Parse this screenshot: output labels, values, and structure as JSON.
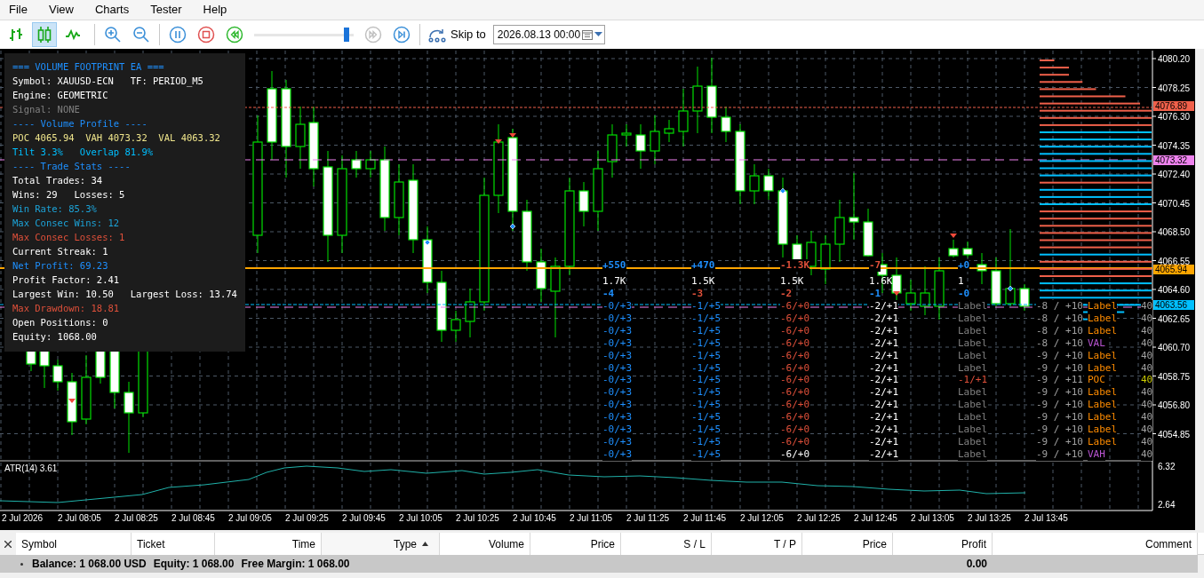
{
  "menu": [
    "File",
    "View",
    "Charts",
    "Tester",
    "Help"
  ],
  "toolbar": {
    "chart_types": [
      {
        "kind": "bars",
        "selected": false
      },
      {
        "kind": "candles",
        "selected": true
      },
      {
        "kind": "line",
        "selected": false
      }
    ],
    "speed": {
      "level": 0.95
    },
    "fast_forward": {
      "disabled": true
    },
    "skip_to": {
      "label": "Skip to",
      "value": "2026.08.13 00:00"
    }
  },
  "chart": {
    "info_panel": [
      {
        "text": "=== VOLUME FOOTPRINT EA ===",
        "color": "#1e90ff"
      },
      {
        "text": "Symbol: XAUUSD-ECN   TF: PERIOD_M5",
        "color": "#ffffff"
      },
      {
        "text": "Engine: GEOMETRIC",
        "color": "#ffffff"
      },
      {
        "text": "Signal: NONE",
        "color": "#808080"
      },
      {
        "text": "---- Volume Profile ----",
        "color": "#1e90ff"
      },
      {
        "text": "POC 4065.94  VAH 4073.32  VAL 4063.32",
        "color": "#f0e68c"
      },
      {
        "text": "Tilt 3.3%   Overlap 81.9%",
        "color": "#00bfff"
      },
      {
        "text": "---- Trade Stats ----",
        "color": "#1e90ff"
      },
      {
        "text": "Total Trades: 34",
        "color": "#ffffff"
      },
      {
        "text": "Wins: 29   Losses: 5",
        "color": "#ffffff"
      },
      {
        "text": "Win Rate: 85.3%",
        "color": "#1ca3d8"
      },
      {
        "text": "Max Consec Wins: 12",
        "color": "#1ca3d8"
      },
      {
        "text": "Max Consec Losses: 1",
        "color": "#e0503a"
      },
      {
        "text": "Current Streak: 1",
        "color": "#ffffff"
      },
      {
        "text": "Net Profit: 69.23",
        "color": "#1e90ff"
      },
      {
        "text": "Profit Factor: 2.41",
        "color": "#ffffff"
      },
      {
        "text": "Largest Win: 10.50   Largest Loss: 13.74",
        "color": "#ffffff"
      },
      {
        "text": "Max Drawdown: 18.81",
        "color": "#e0503a"
      },
      {
        "text": "Open Positions: 0",
        "color": "#ffffff"
      },
      {
        "text": "Equity: 1068.00",
        "color": "#ffffff"
      }
    ],
    "price_axis": [
      "4080.20",
      "4078.25",
      "4076.30",
      "4074.35",
      "4072.40",
      "4070.45",
      "4068.50",
      "4066.55",
      "4064.60",
      "4062.65",
      "4060.70",
      "4058.75",
      "4056.80",
      "4054.85"
    ],
    "price_tags": [
      {
        "text": "4076.89",
        "color": "#f0604a"
      },
      {
        "text": "4073.32",
        "color": "#ee82ee"
      },
      {
        "text": "4065.94",
        "color": "#ffa500"
      },
      {
        "text": "4063.56",
        "color": "#00bfff"
      }
    ],
    "footprint": {
      "columns": [
        {
          "delta": {
            "text": "+550",
            "color": "#1e90ff"
          },
          "volume": "1.7K",
          "imbalance": {
            "text": "-4",
            "color": "#1e90ff"
          },
          "cells": [
            {
              "text": "-0/+3",
              "color": "#1e90ff"
            },
            {
              "text": "-0/+3",
              "color": "#1e90ff"
            },
            {
              "text": "-0/+3",
              "color": "#1e90ff"
            },
            {
              "text": "-0/+3",
              "color": "#1e90ff"
            },
            {
              "text": "-0/+3",
              "color": "#1e90ff"
            },
            {
              "text": "-0/+3",
              "color": "#1e90ff"
            },
            {
              "text": "-0/+3",
              "color": "#1e90ff"
            },
            {
              "text": "-0/+3",
              "color": "#1e90ff"
            },
            {
              "text": "-0/+3",
              "color": "#1e90ff"
            },
            {
              "text": "-0/+3",
              "color": "#1e90ff"
            },
            {
              "text": "-0/+3",
              "color": "#1e90ff"
            },
            {
              "text": "-0/+3",
              "color": "#1e90ff"
            },
            {
              "text": "-0/+3",
              "color": "#1e90ff"
            }
          ]
        },
        {
          "delta": {
            "text": "+470",
            "color": "#1e90ff"
          },
          "volume": "1.5K",
          "imbalance": {
            "text": "-3",
            "color": "#e0503a"
          },
          "cells": [
            {
              "text": "-1/+5",
              "color": "#1e90ff"
            },
            {
              "text": "-1/+5",
              "color": "#1e90ff"
            },
            {
              "text": "-1/+5",
              "color": "#1e90ff"
            },
            {
              "text": "-1/+5",
              "color": "#1e90ff"
            },
            {
              "text": "-1/+5",
              "color": "#1e90ff"
            },
            {
              "text": "-1/+5",
              "color": "#1e90ff"
            },
            {
              "text": "-1/+5",
              "color": "#1e90ff"
            },
            {
              "text": "-1/+5",
              "color": "#1e90ff"
            },
            {
              "text": "-1/+5",
              "color": "#1e90ff"
            },
            {
              "text": "-1/+5",
              "color": "#1e90ff"
            },
            {
              "text": "-1/+5",
              "color": "#1e90ff"
            },
            {
              "text": "-1/+5",
              "color": "#1e90ff"
            },
            {
              "text": "-1/+5",
              "color": "#1e90ff"
            }
          ]
        },
        {
          "delta": {
            "text": "-1.3K",
            "color": "#e0503a"
          },
          "volume": "1.5K",
          "imbalance": {
            "text": "-2",
            "color": "#e0503a"
          },
          "cells": [
            {
              "text": "-6/+0",
              "color": "#e0503a"
            },
            {
              "text": "-6/+0",
              "color": "#e0503a"
            },
            {
              "text": "-6/+0",
              "color": "#e0503a"
            },
            {
              "text": "-6/+0",
              "color": "#e0503a"
            },
            {
              "text": "-6/+0",
              "color": "#e0503a"
            },
            {
              "text": "-6/+0",
              "color": "#e0503a"
            },
            {
              "text": "-6/+0",
              "color": "#e0503a"
            },
            {
              "text": "-6/+0",
              "color": "#e0503a"
            },
            {
              "text": "-6/+0",
              "color": "#e0503a"
            },
            {
              "text": "-6/+0",
              "color": "#e0503a"
            },
            {
              "text": "-6/+0",
              "color": "#e0503a"
            },
            {
              "text": "-6/+0",
              "color": "#e0503a"
            },
            {
              "text": "-6/+0",
              "color": "#ffffff"
            }
          ]
        },
        {
          "delta": {
            "text": "-7",
            "color": "#e0503a"
          },
          "volume": "1.6K",
          "imbalance": {
            "text": "-1",
            "color": "#1e90ff"
          },
          "cells": [
            {
              "text": "-2/+1",
              "color": "#ffffff"
            },
            {
              "text": "-2/+1",
              "color": "#ffffff"
            },
            {
              "text": "-2/+1",
              "color": "#ffffff"
            },
            {
              "text": "-2/+1",
              "color": "#ffffff"
            },
            {
              "text": "-2/+1",
              "color": "#ffffff"
            },
            {
              "text": "-2/+1",
              "color": "#ffffff"
            },
            {
              "text": "-2/+1",
              "color": "#ffffff"
            },
            {
              "text": "-2/+1",
              "color": "#ffffff"
            },
            {
              "text": "-2/+1",
              "color": "#ffffff"
            },
            {
              "text": "-2/+1",
              "color": "#ffffff"
            },
            {
              "text": "-2/+1",
              "color": "#ffffff"
            },
            {
              "text": "-2/+1",
              "color": "#ffffff"
            },
            {
              "text": "-2/+1",
              "color": "#ffffff"
            }
          ]
        },
        {
          "delta": {
            "text": "+0",
            "color": "#1e90ff"
          },
          "volume": "1",
          "imbalance": {
            "text": "-0",
            "color": "#1e90ff"
          },
          "cells": [
            {
              "text": "Label",
              "color": "#808080"
            },
            {
              "text": "Label",
              "color": "#808080"
            },
            {
              "text": "Label",
              "color": "#808080"
            },
            {
              "text": "Label",
              "color": "#808080"
            },
            {
              "text": "Label",
              "color": "#808080"
            },
            {
              "text": "Label",
              "color": "#808080"
            },
            {
              "text": "-1/+1",
              "color": "#e0503a"
            },
            {
              "text": "Label",
              "color": "#808080"
            },
            {
              "text": "Label",
              "color": "#808080"
            },
            {
              "text": "Label",
              "color": "#808080"
            },
            {
              "text": "Label",
              "color": "#808080"
            },
            {
              "text": "Label",
              "color": "#808080"
            },
            {
              "text": "Label",
              "color": "#808080"
            }
          ]
        }
      ],
      "levels": [
        {
          "ratio": "-8 / +10",
          "label": {
            "text": "Label",
            "color": "#ff8c00"
          },
          "count": {
            "text": "40",
            "color": "#a0a0a0"
          }
        },
        {
          "ratio": "-8 / +10",
          "label": {
            "text": "Label",
            "color": "#ff8c00"
          },
          "count": {
            "text": "40",
            "color": "#a0a0a0"
          }
        },
        {
          "ratio": "-8 / +10",
          "label": {
            "text": "Label",
            "color": "#ff8c00"
          },
          "count": {
            "text": "40",
            "color": "#a0a0a0"
          }
        },
        {
          "ratio": "-8 / +10",
          "label": {
            "text": "VAL",
            "color": "#ba55d3"
          },
          "count": {
            "text": "40",
            "color": "#a0a0a0"
          }
        },
        {
          "ratio": "-9 / +10",
          "label": {
            "text": "Label",
            "color": "#ff8c00"
          },
          "count": {
            "text": "40",
            "color": "#a0a0a0"
          }
        },
        {
          "ratio": "-9 / +10",
          "label": {
            "text": "Label",
            "color": "#ff8c00"
          },
          "count": {
            "text": "40",
            "color": "#a0a0a0"
          }
        },
        {
          "ratio": "-9 / +11",
          "label": {
            "text": "POC",
            "color": "#ff8c00"
          },
          "count": {
            "text": "40",
            "color": "#cccc00"
          }
        },
        {
          "ratio": "-9 / +10",
          "label": {
            "text": "Label",
            "color": "#ff8c00"
          },
          "count": {
            "text": "40",
            "color": "#a0a0a0"
          }
        },
        {
          "ratio": "-9 / +10",
          "label": {
            "text": "Label",
            "color": "#ff8c00"
          },
          "count": {
            "text": "40",
            "color": "#a0a0a0"
          }
        },
        {
          "ratio": "-9 / +10",
          "label": {
            "text": "Label",
            "color": "#ff8c00"
          },
          "count": {
            "text": "40",
            "color": "#a0a0a0"
          }
        },
        {
          "ratio": "-9 / +10",
          "label": {
            "text": "Label",
            "color": "#ff8c00"
          },
          "count": {
            "text": "40",
            "color": "#a0a0a0"
          }
        },
        {
          "ratio": "-9 / +10",
          "label": {
            "text": "Label",
            "color": "#ff8c00"
          },
          "count": {
            "text": "40",
            "color": "#a0a0a0"
          }
        },
        {
          "ratio": "-9 / +10",
          "label": {
            "text": "VAH",
            "color": "#ba55d3"
          },
          "count": {
            "text": "40",
            "color": "#a0a0a0"
          }
        }
      ]
    },
    "time_axis": [
      "2 Jul 2026",
      "2 Jul 08:05",
      "2 Jul 08:25",
      "2 Jul 08:45",
      "2 Jul 09:05",
      "2 Jul 09:25",
      "2 Jul 09:45",
      "2 Jul 10:05",
      "2 Jul 10:25",
      "2 Jul 10:45",
      "2 Jul 11:05",
      "2 Jul 11:25",
      "2 Jul 11:45",
      "2 Jul 12:05",
      "2 Jul 12:25",
      "2 Jul 12:45",
      "2 Jul 13:05",
      "2 Jul 13:25",
      "2 Jul 13:45"
    ]
  },
  "indicator": {
    "label": "ATR(14) 3.61",
    "axis": [
      "6.32",
      "2.64"
    ]
  },
  "toolbox": {
    "columns": [
      {
        "label": "Symbol",
        "sorted": false
      },
      {
        "label": "Ticket",
        "sorted": false
      },
      {
        "label": "Time",
        "sorted": false
      },
      {
        "label": "Type",
        "sorted": true
      },
      {
        "label": "Volume",
        "sorted": false
      },
      {
        "label": "Price",
        "sorted": false
      },
      {
        "label": "S / L",
        "sorted": false
      },
      {
        "label": "T / P",
        "sorted": false
      },
      {
        "label": "Price",
        "sorted": false
      },
      {
        "label": "Profit",
        "sorted": false
      },
      {
        "label": "Comment",
        "sorted": false
      }
    ],
    "summary": [
      "Balance: 1 068.00 USD",
      "Equity: 1 068.00",
      "Free Margin: 1 068.00"
    ],
    "profit": "0.00"
  }
}
